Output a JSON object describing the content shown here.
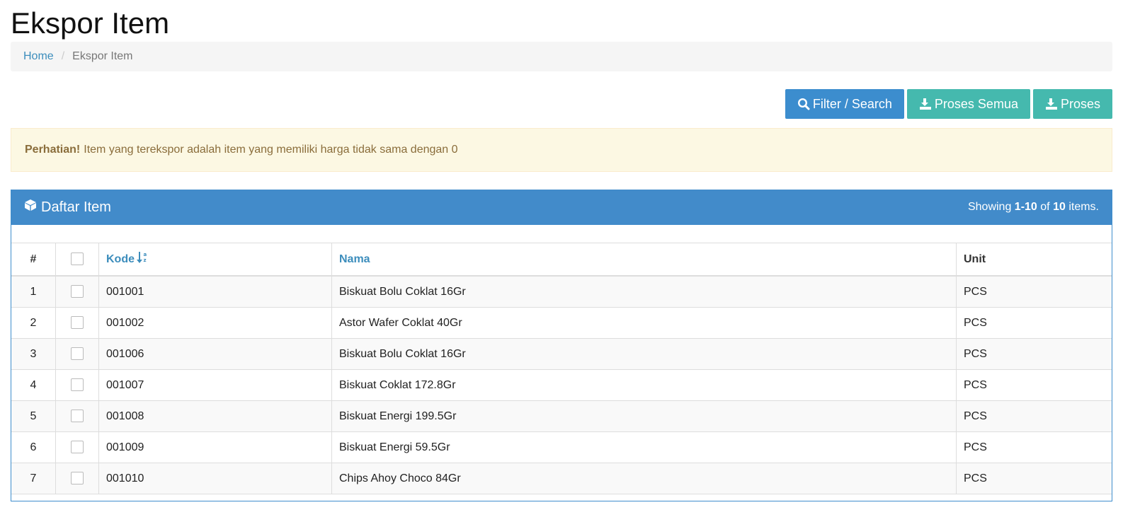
{
  "page": {
    "title": "Ekspor Item"
  },
  "breadcrumb": {
    "home": "Home",
    "separator": "/",
    "current": "Ekspor Item"
  },
  "toolbar": {
    "filter_label": "Filter / Search",
    "proses_semua_label": "Proses Semua",
    "proses_label": "Proses"
  },
  "alert": {
    "title": "Perhatian!",
    "message": "Item yang terekspor adalah item yang memiliki harga tidak sama dengan 0"
  },
  "panel": {
    "title": "Daftar Item",
    "summary": {
      "prefix": "Showing",
      "range": "1-10",
      "of": "of",
      "total": "10",
      "suffix": "items."
    }
  },
  "table": {
    "headers": {
      "no": "#",
      "kode": "Kode",
      "nama": "Nama",
      "unit": "Unit"
    },
    "rows": [
      {
        "no": "1",
        "kode": "001001",
        "nama": "Biskuat Bolu Coklat 16Gr",
        "unit": "PCS"
      },
      {
        "no": "2",
        "kode": "001002",
        "nama": "Astor Wafer Coklat 40Gr",
        "unit": "PCS"
      },
      {
        "no": "3",
        "kode": "001006",
        "nama": "Biskuat Bolu Coklat 16Gr",
        "unit": "PCS"
      },
      {
        "no": "4",
        "kode": "001007",
        "nama": "Biskuat Coklat 172.8Gr",
        "unit": "PCS"
      },
      {
        "no": "5",
        "kode": "001008",
        "nama": "Biskuat Energi 199.5Gr",
        "unit": "PCS"
      },
      {
        "no": "6",
        "kode": "001009",
        "nama": "Biskuat Energi 59.5Gr",
        "unit": "PCS"
      },
      {
        "no": "7",
        "kode": "001010",
        "nama": "Chips Ahoy Choco 84Gr",
        "unit": "PCS"
      }
    ]
  },
  "icons": {
    "filter": "search-icon",
    "proses": "export-icon",
    "panel": "cube-icon",
    "sort": "sort-alpha-icon"
  },
  "colors": {
    "primary": "#428bca",
    "teal": "#45b9ae",
    "link": "#3c8dbc",
    "alert_bg": "#fcf8e3",
    "alert_text": "#8a6d3b"
  }
}
